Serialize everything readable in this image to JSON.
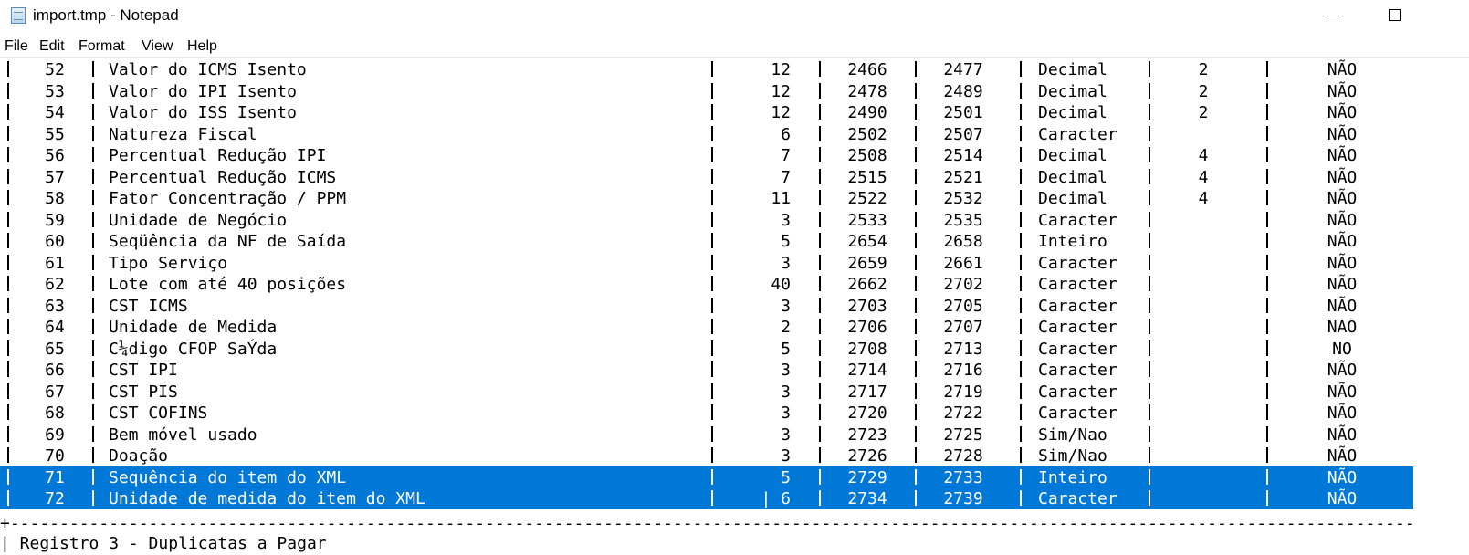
{
  "window": {
    "title": "import.tmp - Notepad"
  },
  "menu": [
    "File",
    "Edit",
    "Format",
    "View",
    "Help"
  ],
  "rows": [
    {
      "num": "52",
      "desc": "Valor do ICMS Isento",
      "len": "12",
      "ini": "2466",
      "fim": "2477",
      "tipo": "Decimal",
      "dec": "2",
      "obr": "NÃO"
    },
    {
      "num": "53",
      "desc": "Valor do IPI Isento",
      "len": "12",
      "ini": "2478",
      "fim": "2489",
      "tipo": "Decimal",
      "dec": "2",
      "obr": "NÃO"
    },
    {
      "num": "54",
      "desc": "Valor do ISS Isento",
      "len": "12",
      "ini": "2490",
      "fim": "2501",
      "tipo": "Decimal",
      "dec": "2",
      "obr": "NÃO"
    },
    {
      "num": "55",
      "desc": "Natureza Fiscal",
      "len": "6",
      "ini": "2502",
      "fim": "2507",
      "tipo": "Caracter",
      "dec": "",
      "obr": "NÃO"
    },
    {
      "num": "56",
      "desc": "Percentual Redução IPI",
      "len": "7",
      "ini": "2508",
      "fim": "2514",
      "tipo": "Decimal",
      "dec": "4",
      "obr": "NÃO"
    },
    {
      "num": "57",
      "desc": "Percentual Redução ICMS",
      "len": "7",
      "ini": "2515",
      "fim": "2521",
      "tipo": "Decimal",
      "dec": "4",
      "obr": "NÃO"
    },
    {
      "num": "58",
      "desc": "Fator Concentração / PPM",
      "len": "11",
      "ini": "2522",
      "fim": "2532",
      "tipo": "Decimal",
      "dec": "4",
      "obr": "NÃO"
    },
    {
      "num": "59",
      "desc": "Unidade de Negócio",
      "len": "3",
      "ini": "2533",
      "fim": "2535",
      "tipo": "Caracter",
      "dec": "",
      "obr": "NÃO"
    },
    {
      "num": "60",
      "desc": "Seqüência da NF de Saída",
      "len": "5",
      "ini": "2654",
      "fim": "2658",
      "tipo": "Inteiro",
      "dec": "",
      "obr": "NÃO"
    },
    {
      "num": "61",
      "desc": "Tipo Serviço",
      "len": "3",
      "ini": "2659",
      "fim": "2661",
      "tipo": "Caracter",
      "dec": "",
      "obr": "NÃO"
    },
    {
      "num": "62",
      "desc": "Lote com até 40 posições",
      "len": "40",
      "ini": "2662",
      "fim": "2702",
      "tipo": "Caracter",
      "dec": "",
      "obr": "NÃO"
    },
    {
      "num": "63",
      "desc": "CST ICMS",
      "len": "3",
      "ini": "2703",
      "fim": "2705",
      "tipo": "Caracter",
      "dec": "",
      "obr": "NÃO"
    },
    {
      "num": "64",
      "desc": "Unidade de Medida",
      "len": "2",
      "ini": "2706",
      "fim": "2707",
      "tipo": "Caracter",
      "dec": "",
      "obr": "NAO"
    },
    {
      "num": "65",
      "desc": "C¼digo CFOP SaÝda",
      "len": "5",
      "ini": "2708",
      "fim": "2713",
      "tipo": "Caracter",
      "dec": "",
      "obr": "NO"
    },
    {
      "num": "66",
      "desc": "CST IPI",
      "len": "3",
      "ini": "2714",
      "fim": "2716",
      "tipo": "Caracter",
      "dec": "",
      "obr": "NÃO"
    },
    {
      "num": "67",
      "desc": "CST PIS",
      "len": "3",
      "ini": "2717",
      "fim": "2719",
      "tipo": "Caracter",
      "dec": "",
      "obr": "NÃO"
    },
    {
      "num": "68",
      "desc": "CST COFINS",
      "len": "3",
      "ini": "2720",
      "fim": "2722",
      "tipo": "Caracter",
      "dec": "",
      "obr": "NÃO"
    },
    {
      "num": "69",
      "desc": "Bem móvel usado",
      "len": "3",
      "ini": "2723",
      "fim": "2725",
      "tipo": "Sim/Nao",
      "dec": "",
      "obr": "NÃO"
    },
    {
      "num": "70",
      "desc": "Doação",
      "len": "3",
      "ini": "2726",
      "fim": "2728",
      "tipo": "Sim/Nao",
      "dec": "",
      "obr": "NÃO"
    },
    {
      "num": "71",
      "desc": "Sequência do item do XML",
      "len": "5",
      "ini": "2729",
      "fim": "2733",
      "tipo": "Inteiro",
      "dec": "",
      "obr": "NÃO",
      "selected": true
    },
    {
      "num": "72",
      "desc": "Unidade de medida do item do XML",
      "len": "| 6",
      "ini": "2734",
      "fim": "2739",
      "tipo": "Caracter",
      "dec": "",
      "obr": "NÃO",
      "selected": true
    }
  ],
  "separator": "+-------------------------------------------------------------------------------------------------------------------------------------------------------------------------",
  "next_line": "| Registro 3 - Duplicatas a Pagar"
}
